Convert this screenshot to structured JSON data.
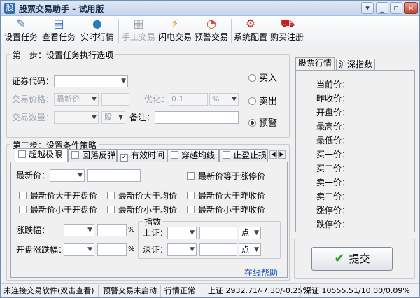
{
  "titlebar": {
    "title": "股票交易助手 - 试用版",
    "app_icon": "股",
    "btn_down": "▾",
    "btn_min": "_",
    "btn_max": "▫",
    "btn_close": "×"
  },
  "toolbar": {
    "items": [
      {
        "label": "设置任务",
        "icon": "✎",
        "color": "#3d6fb8"
      },
      {
        "label": "查看任务",
        "icon": "▤",
        "color": "#3d6fb8"
      },
      {
        "label": "实时行情",
        "icon": "●",
        "color": "#2a7db4"
      },
      {
        "label": "手工交易",
        "icon": "▦",
        "color": "#9aa3ad"
      },
      {
        "label": "闪电交易",
        "icon": "⚡",
        "color": "#e89a1c"
      },
      {
        "label": "预警交易",
        "icon": "◔",
        "color": "#d94f2a"
      },
      {
        "label": "系统配置",
        "icon": "⚙",
        "color": "#c62c2c"
      },
      {
        "label": "购买注册",
        "icon": "⛟",
        "color": "#c22020"
      }
    ]
  },
  "step1": {
    "title": "第一步：设置任务执行选项",
    "code_label": "证券代码：",
    "code_value": "",
    "price_label": "交易价格：",
    "price_type": "最新价",
    "price_value": "",
    "optimize_label": "优化：",
    "optimize_value": "0.1",
    "optimize_unit": "%",
    "qty_label": "交易数量：",
    "qty_value": "",
    "qty_unit": "股",
    "note_label": "备注：",
    "note_value": "",
    "radio_buy": "买入",
    "radio_sell": "卖出",
    "radio_alert": "预警",
    "selected": "预警"
  },
  "step2": {
    "title": "第二步：设置条件策略",
    "tabs": [
      {
        "label": "超越极限",
        "checked": false
      },
      {
        "label": "回落反弹",
        "checked": false
      },
      {
        "label": "有效时间",
        "checked": true
      },
      {
        "label": "穿越均线",
        "checked": false
      },
      {
        "label": "止盈止损",
        "checked": false
      }
    ],
    "nav_left": "◀",
    "nav_right": "▶",
    "latest_label": "最新价：",
    "latest_op": "",
    "latest_value": "",
    "conditions": [
      "最新价等于涨停价",
      "最新价大于开盘价",
      "最新价大于均价",
      "最新价大于昨收价",
      "最新价小于开盘价",
      "最新价小于均价",
      "最新价小于昨收价"
    ],
    "change_label": "涨跌幅：",
    "open_change_label": "开盘涨跌幅：",
    "pct": "%",
    "index_title": "指数",
    "sh_label": "上证：",
    "sz_label": "深证：",
    "point_unit": "点",
    "online_help": "在线帮助"
  },
  "quote": {
    "tab_stock": "股票行情",
    "tab_index": "沪深指数",
    "fields": [
      "当前价：",
      "昨收价：",
      "开盘价：",
      "最高价：",
      "最低价：",
      "买一价：",
      "买二价：",
      "卖一价：",
      "卖二价：",
      "涨停价：",
      "跌停价："
    ]
  },
  "submit": {
    "label": "提交",
    "icon": "✔"
  },
  "status": {
    "conn": "未连接交易软件(双击查看)",
    "alert": "预警交易未启动",
    "market": "行情正常",
    "sh": "上证  2932.71/-7.30/-0.25%",
    "sz": "深证  10555.51/10.00/0.09%"
  },
  "colors": {
    "accent": "#3d6fb8",
    "link": "#1a55b8",
    "check_green": "#2f9a2f"
  }
}
